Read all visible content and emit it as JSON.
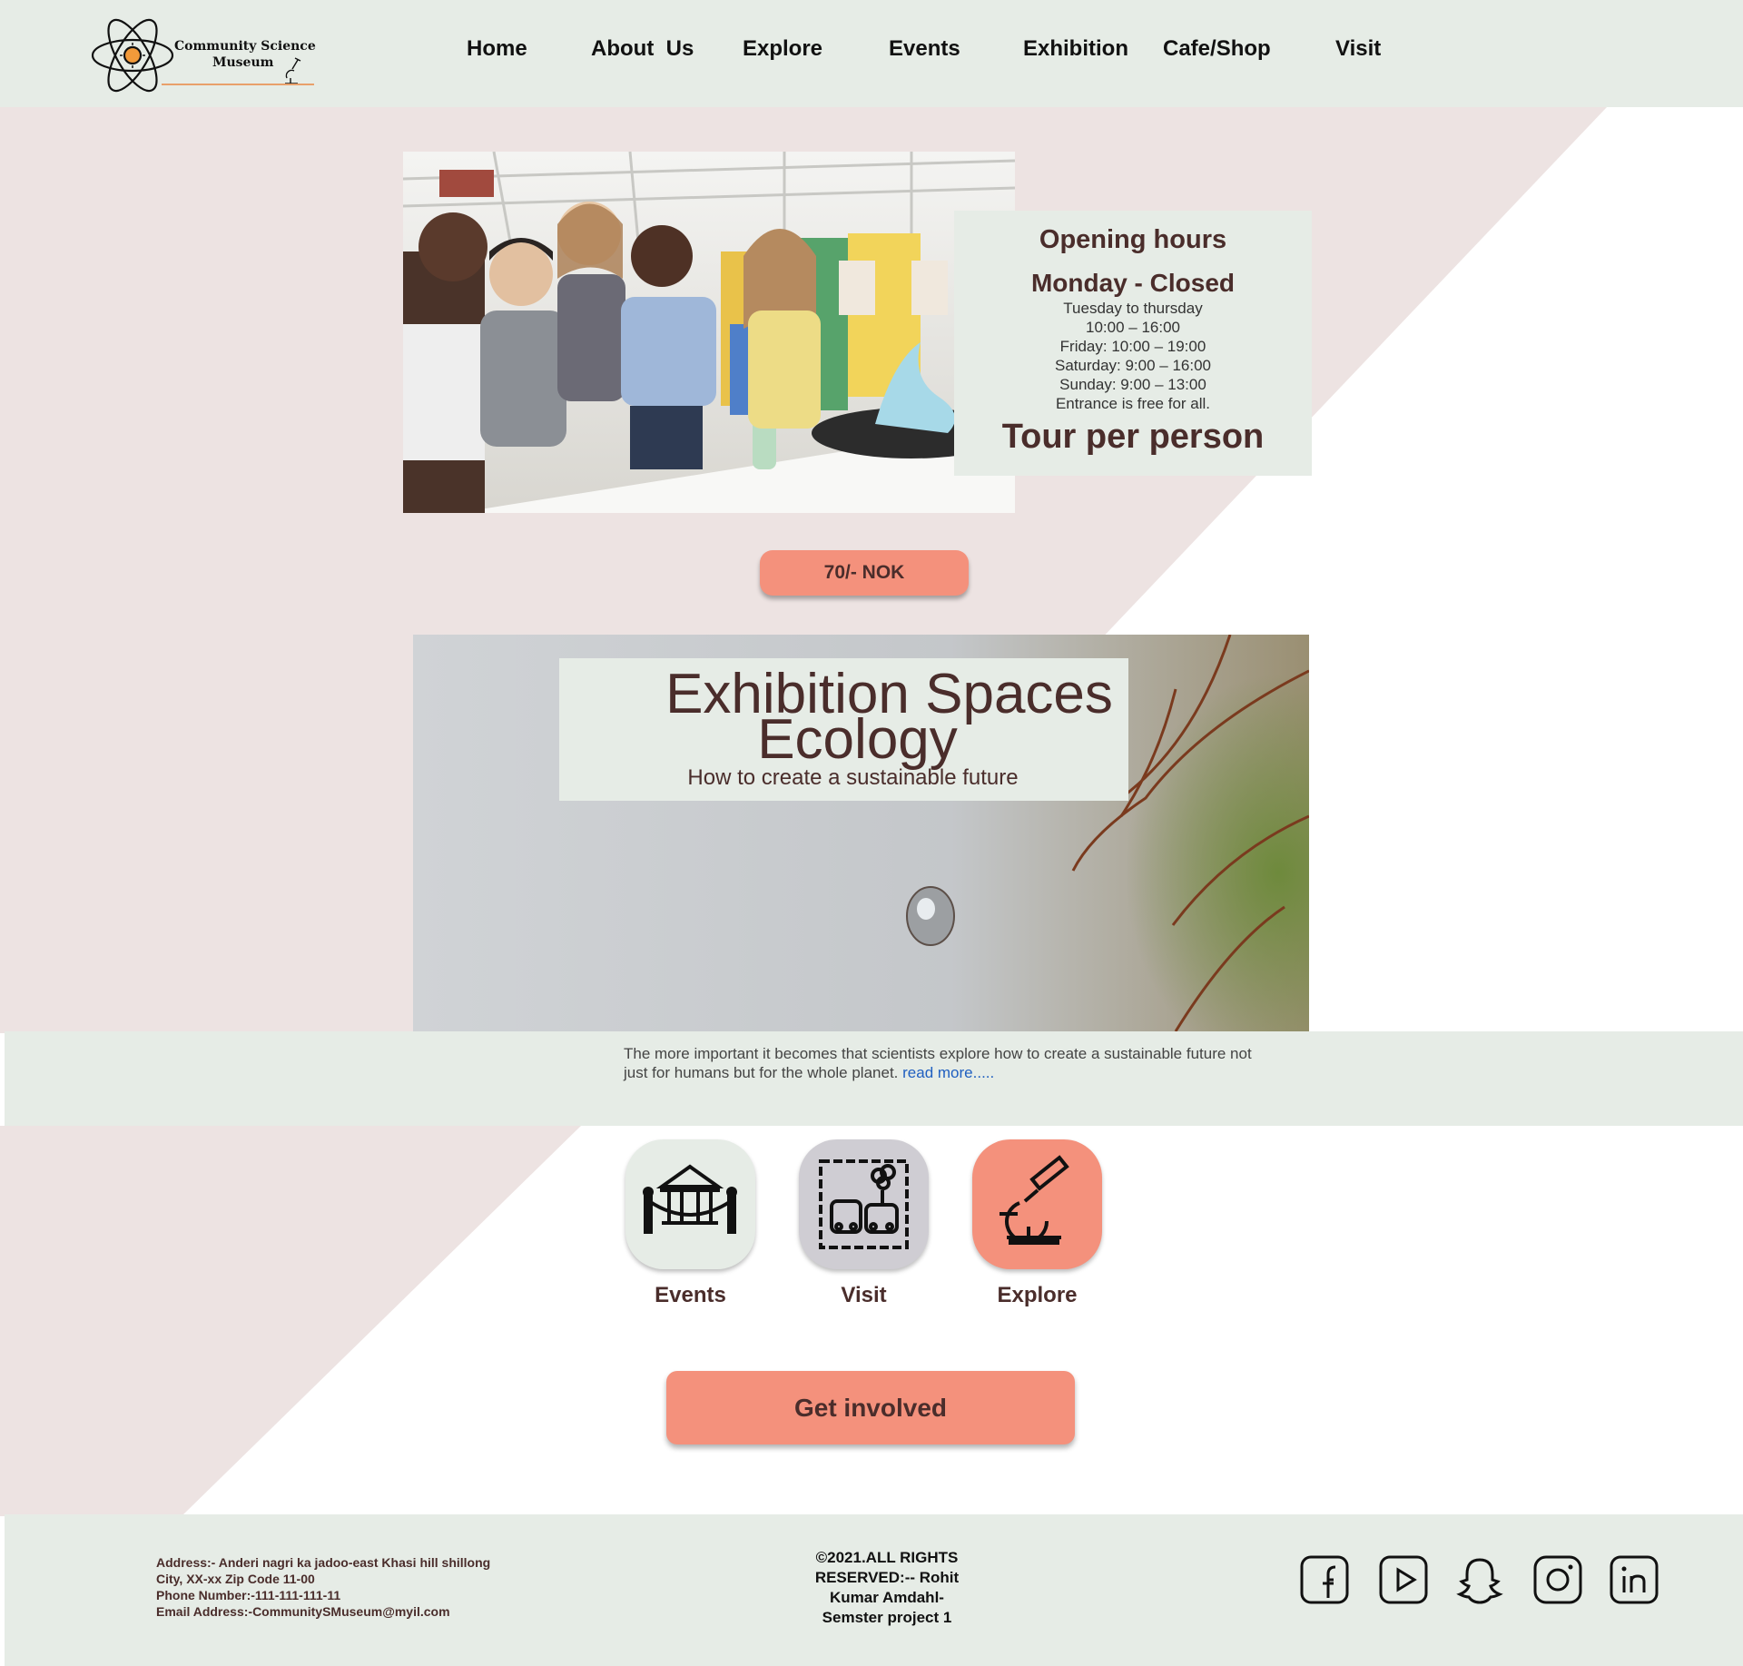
{
  "header": {
    "logo": {
      "line1": "Community Science",
      "line2": "Museum"
    },
    "nav": [
      "Home",
      "About  Us",
      "Explore",
      "Events",
      "Exhibition",
      "Cafe/Shop",
      "Visit"
    ]
  },
  "hours": {
    "title": "Opening hours",
    "monday": "Monday - Closed",
    "lines": [
      "Tuesday to thursday",
      "10:00 – 16:00",
      "Friday: 10:00 – 19:00",
      "Saturday: 9:00 – 16:00",
      "Sunday: 9:00 – 13:00",
      "Entrance is free for all."
    ],
    "tour": "Tour per person"
  },
  "price_button": "70/- NOK",
  "exhibition": {
    "title_line1": "Exhibition Spaces",
    "title_line2": "Ecology",
    "subtitle": "How to create a sustainable future"
  },
  "description": {
    "text": "The more important it becomes that scientists explore how to create a sustainable future not just for humans but for the whole planet.",
    "link": "read more....."
  },
  "tiles": [
    {
      "label": "Events",
      "icon": "museum-building-icon",
      "color": "#e6ece6"
    },
    {
      "label": "Visit",
      "icon": "cars-balloons-icon",
      "color": "#cfcdd3"
    },
    {
      "label": "Explore",
      "icon": "microscope-icon",
      "color": "#f4917c"
    }
  ],
  "get_involved": "Get involved",
  "footer": {
    "address": [
      "Address:- Anderi nagri ka jadoo-east Khasi hill shillong",
      "City, XX-xx Zip Code 11-00",
      "Phone Number:-111-111-111-11",
      "Email Address:-CommunitySMuseum@myil.com"
    ],
    "copyright": [
      "©2021.ALL RIGHTS",
      "RESERVED:-- Rohit",
      "Kumar Amdahl-",
      "Semster project 1"
    ],
    "social": [
      "facebook-icon",
      "youtube-icon",
      "snapchat-icon",
      "instagram-icon",
      "linkedin-icon"
    ]
  },
  "colors": {
    "accent": "#f4917c",
    "panel": "#e6ece6",
    "pink_bg": "#ede3e2",
    "text": "#4a2d2b",
    "link": "#1f5fc0"
  }
}
